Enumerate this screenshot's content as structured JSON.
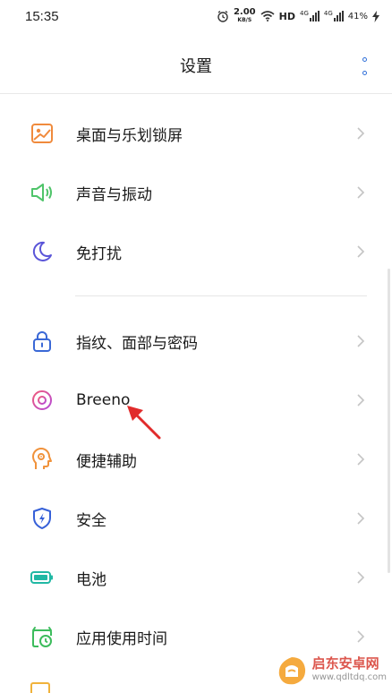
{
  "status_bar": {
    "time": "15:35",
    "net_speed_value": "2.00",
    "net_speed_unit": "KB/S",
    "hd_label": "HD",
    "signal1_label": "4G",
    "signal2_label": "4G",
    "battery": "41%"
  },
  "header": {
    "title": "设置"
  },
  "settings": {
    "items": [
      {
        "label": "桌面与乐划锁屏",
        "icon": "wallpaper-icon"
      },
      {
        "label": "声音与振动",
        "icon": "speaker-icon"
      },
      {
        "label": "免打扰",
        "icon": "moon-icon"
      },
      {
        "label": "指纹、面部与密码",
        "icon": "lock-icon"
      },
      {
        "label": "Breeno",
        "icon": "breeno-icon"
      },
      {
        "label": "便捷辅助",
        "icon": "assist-icon"
      },
      {
        "label": "安全",
        "icon": "shield-icon"
      },
      {
        "label": "电池",
        "icon": "battery-icon"
      },
      {
        "label": "应用使用时间",
        "icon": "app-timer-icon"
      }
    ]
  },
  "watermark": {
    "title": "启东安卓网",
    "url": "www.qdltdq.com"
  },
  "colors": {
    "accent_blue": "#2f6fd8",
    "wallpaper_orange": "#f08a3c",
    "sound_green": "#4fc46a",
    "moon_indigo": "#5a55d8",
    "lock_blue": "#3a68d6",
    "breeno_pink": "#e0458f",
    "assist_orange": "#f0923b",
    "shield_blue": "#3660d8",
    "battery_teal": "#21b8a4",
    "timer_green": "#3cbc5c",
    "arrow_red": "#e12b2b"
  }
}
